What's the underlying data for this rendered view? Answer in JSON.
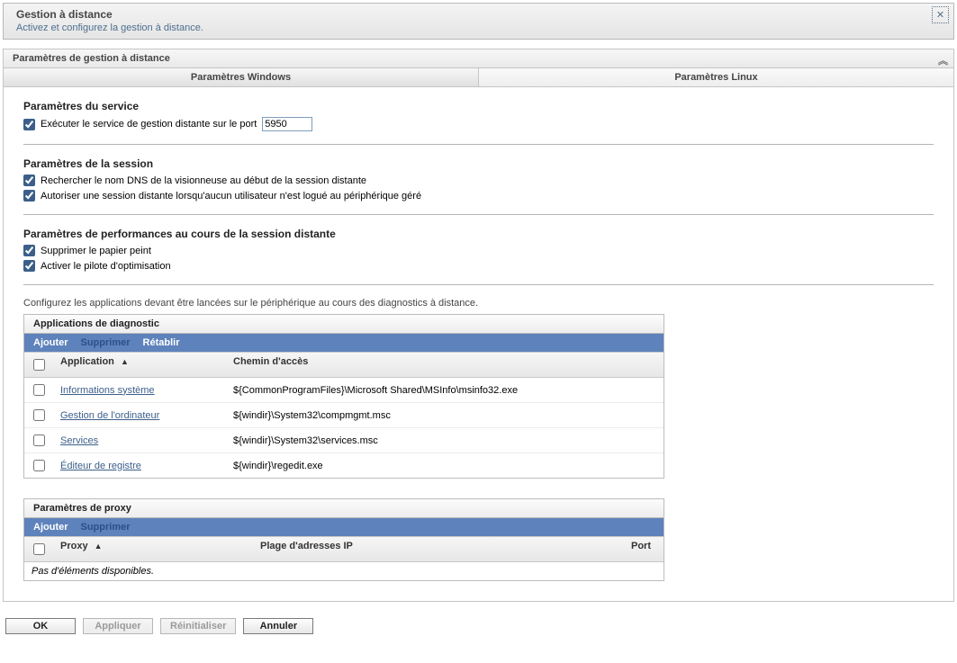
{
  "banner": {
    "title": "Gestion à distance",
    "subtitle": "Activez et configurez la gestion à distance."
  },
  "accordion": {
    "title": "Paramètres de gestion à distance"
  },
  "tabs": {
    "windows": "Paramètres Windows",
    "linux": "Paramètres Linux"
  },
  "service": {
    "heading": "Paramètres du service",
    "run_label": "Exécuter le service de gestion distante sur le port",
    "port_value": "5950"
  },
  "session": {
    "heading": "Paramètres de la session",
    "dns_label": "Rechercher le nom DNS de la visionneuse au début de la session distante",
    "allow_label": "Autoriser une session distante lorsqu'aucun utilisateur n'est logué au périphérique géré"
  },
  "perf": {
    "heading": "Paramètres de performances au cours de la session distante",
    "wallpaper_label": "Supprimer le papier peint",
    "driver_label": "Activer le pilote d'optimisation"
  },
  "diag_hint": "Configurez les applications devant être lancées sur le périphérique au cours des diagnostics à distance.",
  "apps_table": {
    "title": "Applications de diagnostic",
    "actions": {
      "add": "Ajouter",
      "del": "Supprimer",
      "reset": "Rétablir"
    },
    "cols": {
      "app": "Application",
      "path": "Chemin d'accès"
    },
    "rows": [
      {
        "app": "Informations système",
        "path": "${CommonProgramFiles}\\Microsoft Shared\\MSInfo\\msinfo32.exe"
      },
      {
        "app": "Gestion de l'ordinateur",
        "path": "${windir}\\System32\\compmgmt.msc"
      },
      {
        "app": "Services",
        "path": "${windir}\\System32\\services.msc"
      },
      {
        "app": "Éditeur de registre",
        "path": "${windir}\\regedit.exe"
      }
    ]
  },
  "proxy_table": {
    "title": "Paramètres de proxy",
    "actions": {
      "add": "Ajouter",
      "del": "Supprimer"
    },
    "cols": {
      "proxy": "Proxy",
      "ip": "Plage d'adresses IP",
      "port": "Port"
    },
    "empty": "Pas d'éléments disponibles."
  },
  "footer": {
    "ok": "OK",
    "apply": "Appliquer",
    "reset": "Réinitialiser",
    "cancel": "Annuler"
  }
}
